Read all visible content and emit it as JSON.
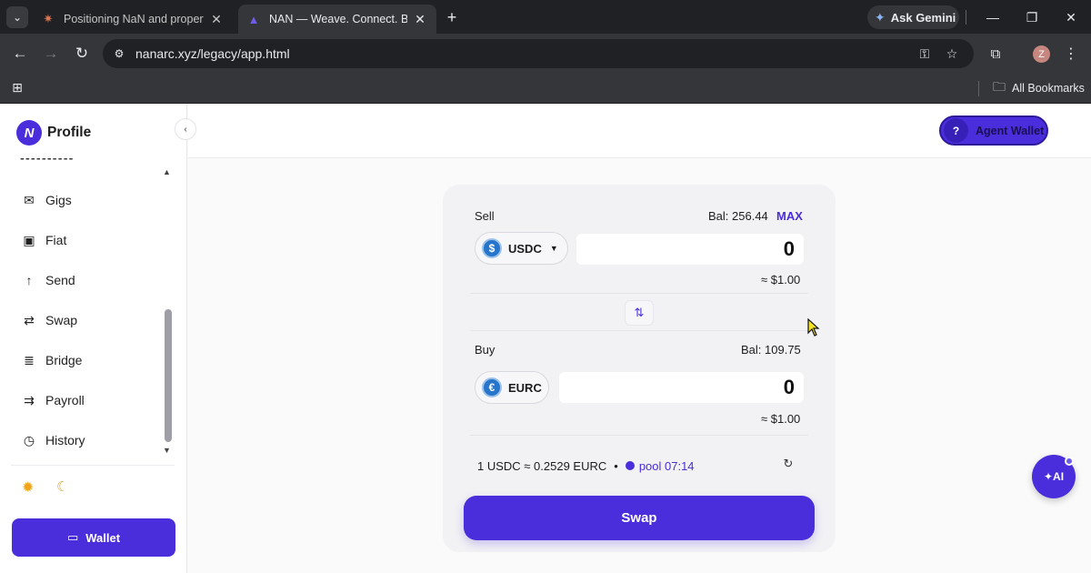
{
  "browser": {
    "tabs": [
      {
        "title": "Positioning NaN and properties",
        "favicon": "claude-icon",
        "active": false
      },
      {
        "title": "NAN — Weave. Connect. Build.",
        "favicon": "nan-logo-icon",
        "active": true
      }
    ],
    "ask_gemini": "Ask Gemini",
    "url": "nanarc.xyz/legacy/app.html",
    "profile_initial": "Z",
    "all_bookmarks": "All Bookmarks"
  },
  "sidebar": {
    "title": "Profile",
    "logo_letter": "N",
    "items": [
      {
        "label": "Gigs",
        "icon": "inbox-icon"
      },
      {
        "label": "Fiat",
        "icon": "cash-icon"
      },
      {
        "label": "Send",
        "icon": "arrow-up-icon"
      },
      {
        "label": "Swap",
        "icon": "swap-icon"
      },
      {
        "label": "Bridge",
        "icon": "bridge-icon"
      },
      {
        "label": "Payroll",
        "icon": "payroll-icon"
      },
      {
        "label": "History",
        "icon": "clock-icon"
      }
    ],
    "wallet_label": "Wallet"
  },
  "header": {
    "agent_wallet_label": "Agent Wallet",
    "agent_wallet_badge": "?"
  },
  "swap": {
    "sell": {
      "label": "Sell",
      "balance": "Bal: 256.44",
      "max_label": "MAX",
      "token": "USDC",
      "amount": "0",
      "usd_value": "≈ $1.00"
    },
    "buy": {
      "label": "Buy",
      "balance": "Bal: 109.75",
      "token": "EURC",
      "amount": "0",
      "usd_value": "≈ $1.00"
    },
    "rate": "1 USDC ≈ 0.2529 EURC",
    "separator": "•",
    "pool": "pool 07:14",
    "button_label": "Swap"
  },
  "fab": {
    "label": "✦AI"
  },
  "colors": {
    "accent": "#4a2ddb",
    "accent_dark": "#2d1a99",
    "usdc_blue": "#2775ca"
  }
}
